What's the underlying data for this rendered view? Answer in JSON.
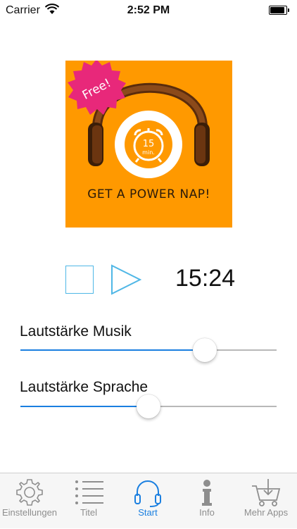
{
  "status_bar": {
    "carrier": "Carrier",
    "time": "2:52 PM"
  },
  "artwork": {
    "badge_text": "Free!",
    "timer_number": "15",
    "timer_unit": "min.",
    "caption": "GET A POWER NAP!"
  },
  "player": {
    "time_remaining": "15:24"
  },
  "sliders": [
    {
      "label": "Lautstärke Musik",
      "value": 0.72
    },
    {
      "label": "Lautstärke Sprache",
      "value": 0.5
    }
  ],
  "tabs": [
    {
      "label": "Einstellungen",
      "icon": "gear-icon",
      "active": false
    },
    {
      "label": "Titel",
      "icon": "list-icon",
      "active": false
    },
    {
      "label": "Start",
      "icon": "headphones-icon",
      "active": true
    },
    {
      "label": "Info",
      "icon": "info-icon",
      "active": false
    },
    {
      "label": "Mehr Apps",
      "icon": "cart-icon",
      "active": false
    }
  ],
  "colors": {
    "accent": "#1a7fe0",
    "artwork_bg": "#ff9900",
    "badge": "#e8287a",
    "controls": "#4fb7e6"
  }
}
